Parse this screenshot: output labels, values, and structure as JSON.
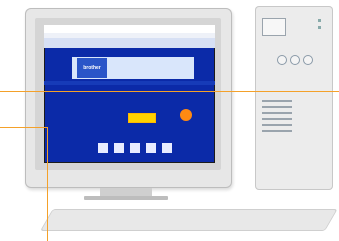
{
  "screen": {
    "brand": "brother"
  },
  "colors": {
    "screen_bg": "#0b2aa8",
    "accent_orange": "#ff8a12",
    "highlight_yellow": "#ffd200"
  }
}
